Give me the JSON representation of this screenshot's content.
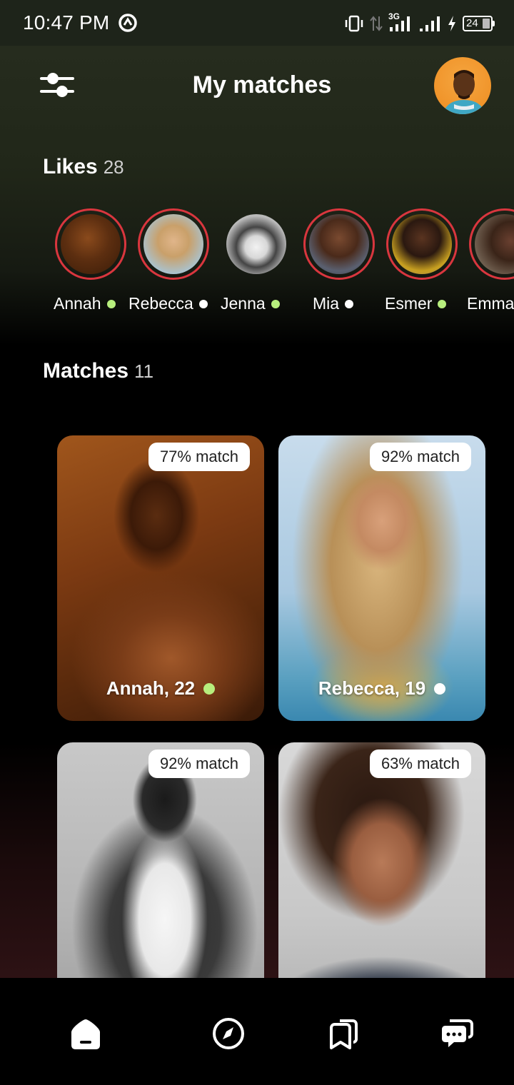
{
  "status_bar": {
    "time": "10:47 PM",
    "network": "3G",
    "battery": "24"
  },
  "header": {
    "title": "My matches",
    "filter_icon": "sliders-icon",
    "avatar_icon": "user-avatar"
  },
  "likes": {
    "title": "Likes",
    "count": "28",
    "items": [
      {
        "name": "Annah",
        "status": "green",
        "ring": true
      },
      {
        "name": "Rebecca",
        "status": "white",
        "ring": true
      },
      {
        "name": "Jenna",
        "status": "green",
        "ring": false
      },
      {
        "name": "Mia",
        "status": "white",
        "ring": true
      },
      {
        "name": "Esmer",
        "status": "green",
        "ring": true
      },
      {
        "name": "Emma",
        "status": "none",
        "ring": true
      }
    ]
  },
  "matches": {
    "title": "Matches",
    "count": "11",
    "cards": [
      {
        "match": "77% match",
        "name": "Annah, 22",
        "status": "green"
      },
      {
        "match": "92% match",
        "name": "Rebecca, 19",
        "status": "white"
      },
      {
        "match": "92% match",
        "name": "",
        "status": "none"
      },
      {
        "match": "63% match",
        "name": "",
        "status": "none"
      }
    ]
  },
  "bottom_nav": {
    "items": [
      "home-icon",
      "compass-icon",
      "cards-icon",
      "chat-icon"
    ]
  },
  "colors": {
    "online_dot": "#b7ee7d",
    "like_ring": "#d9363e",
    "header_bg": "#262c1e"
  }
}
